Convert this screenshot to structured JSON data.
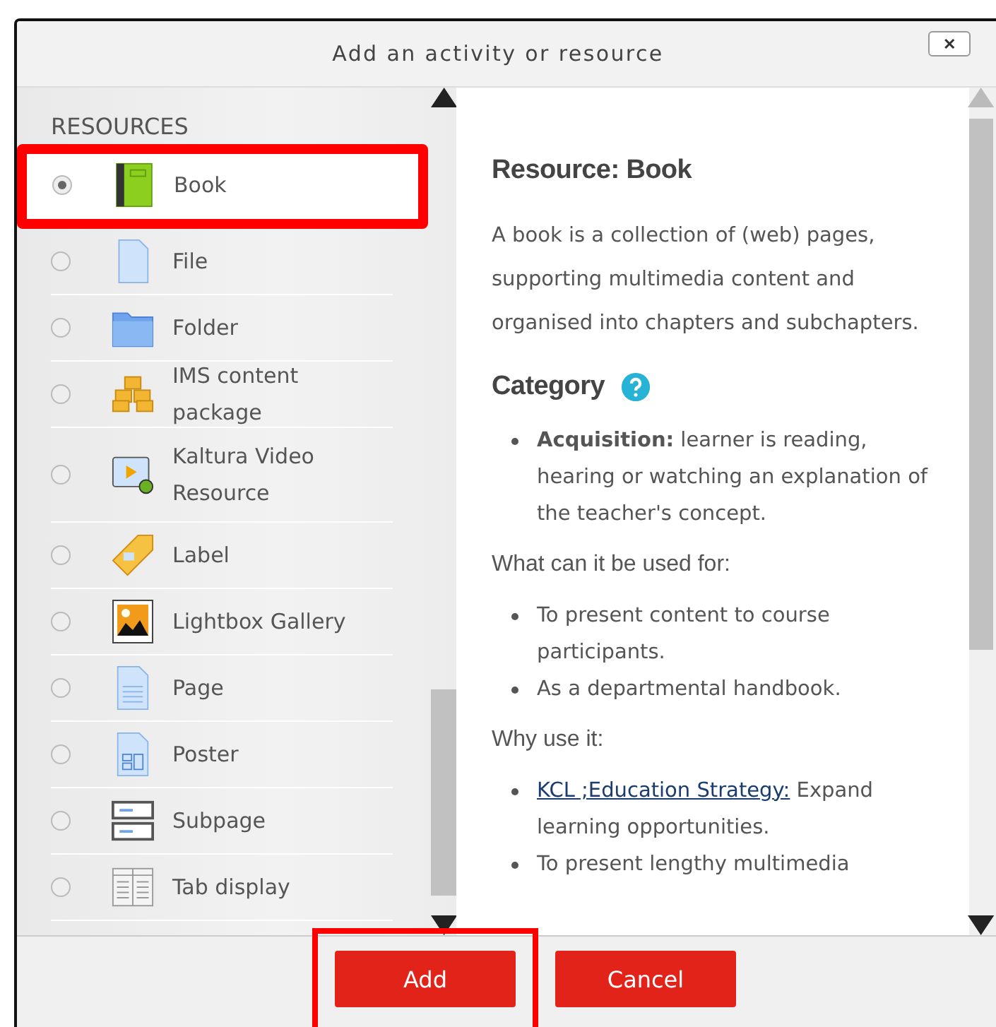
{
  "dialog": {
    "title": "Add an activity or resource",
    "close": "✕"
  },
  "section_label": "RESOURCES",
  "items": [
    {
      "label": "Book",
      "kind": "book",
      "selected": true,
      "highlighted": true
    },
    {
      "label": "File",
      "kind": "file",
      "selected": false,
      "highlighted": false
    },
    {
      "label": "Folder",
      "kind": "folder",
      "selected": false,
      "highlighted": false
    },
    {
      "label": "IMS content package",
      "kind": "package",
      "selected": false,
      "highlighted": false
    },
    {
      "label": "Kaltura Video Resource",
      "kind": "video",
      "selected": false,
      "highlighted": false
    },
    {
      "label": "Label",
      "kind": "tag",
      "selected": false,
      "highlighted": false
    },
    {
      "label": "Lightbox Gallery",
      "kind": "gallery",
      "selected": false,
      "highlighted": false
    },
    {
      "label": "Page",
      "kind": "page",
      "selected": false,
      "highlighted": false
    },
    {
      "label": "Poster",
      "kind": "poster",
      "selected": false,
      "highlighted": false
    },
    {
      "label": "Subpage",
      "kind": "subpage",
      "selected": false,
      "highlighted": false
    },
    {
      "label": "Tab display",
      "kind": "tabs",
      "selected": false,
      "highlighted": false
    }
  ],
  "details": {
    "title": "Resource: Book",
    "description": "A book is a collection of (web) pages, supporting multimedia content and organised into chapters and subchapters.",
    "category_heading": "Category",
    "category_items": [
      "**Acquisition:** learner is reading, hearing or watching an explanation of the teacher's concept."
    ],
    "uses_heading": "What can it be used for:",
    "uses": [
      "To present content to course participants.",
      "As a departmental handbook."
    ],
    "why_heading": "Why use it:",
    "why": [
      {
        "link": "KCL ;Education Strategy:",
        "text": " Expand learning opportunities."
      },
      {
        "text": "To present lengthy multimedia"
      }
    ]
  },
  "buttons": [
    {
      "label": "Add",
      "highlighted": true
    },
    {
      "label": "Cancel",
      "highlighted": false
    }
  ]
}
